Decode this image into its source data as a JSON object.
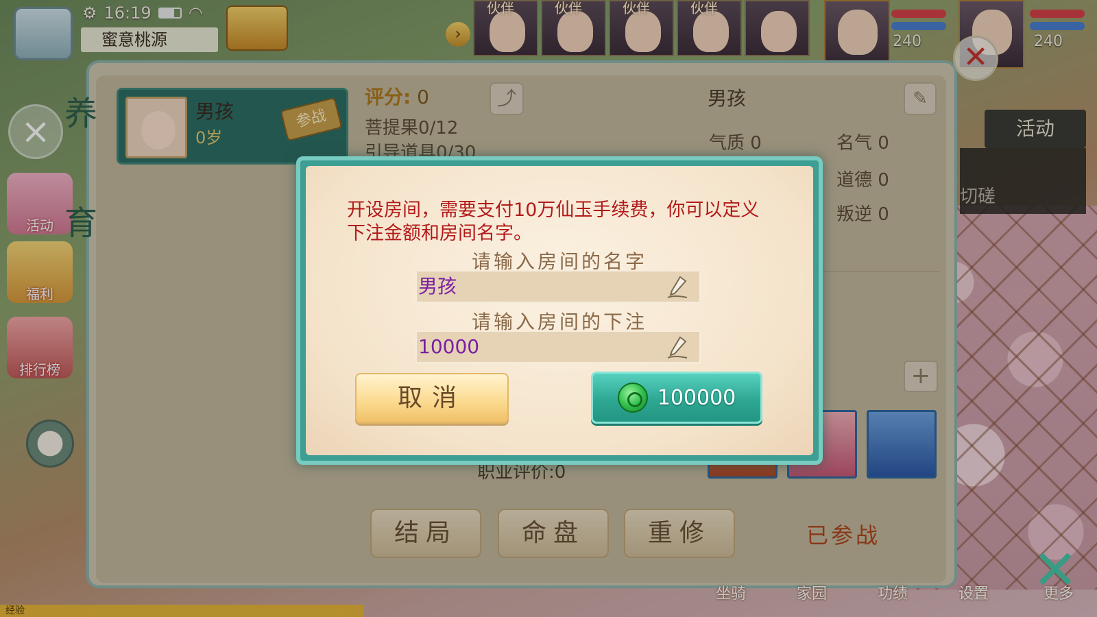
{
  "status": {
    "time": "16:19",
    "location": "蜜意桃源"
  },
  "partners": [
    {
      "label": "伙伴"
    },
    {
      "label": "伙伴"
    },
    {
      "label": "伙伴"
    },
    {
      "label": "伙伴"
    }
  ],
  "heroes": [
    {
      "level": "240"
    },
    {
      "level": "240"
    }
  ],
  "side_menu": {
    "huodong": "活动",
    "fuli": "福利",
    "paihang": "排行榜",
    "exp": "经验"
  },
  "panel": {
    "title_chars": [
      "养",
      "育"
    ],
    "child": {
      "name": "男孩",
      "age": "0岁",
      "battle_tag": "参战"
    },
    "score_label": "评分:",
    "score_value": "0",
    "fruit": "菩提果0/12",
    "guide": "引导道具0/30",
    "right_name": "男孩",
    "stats": {
      "qizhi_label": "气质",
      "qizhi_value": "0",
      "mingqi_label": "名气",
      "mingqi_value": "0",
      "daode_label": "道德",
      "daode_value": "0",
      "panni_label": "叛逆",
      "panni_value": "0"
    },
    "job_eval": "职业评价:0",
    "buttons": {
      "jieju": "结局",
      "mingpan": "命盘",
      "chongxiu": "重修"
    },
    "joined": "已参战",
    "activity_tab": "活动",
    "activity_text": "切磋"
  },
  "bottom_nav": {
    "zuoqi": "坐骑",
    "jiayuan": "家园",
    "gongji": "功绩",
    "shezhi": "设置",
    "gengduo": "更多"
  },
  "dialog": {
    "message": "开设房间，需要支付10万仙玉手续费，你可以定义下注金额和房间名字。",
    "name_label": "请输入房间的名字",
    "name_value": "男孩",
    "bet_label": "请输入房间的下注",
    "bet_value": "10000",
    "cancel_label": "取消",
    "pay_amount": "100000"
  },
  "colors": {
    "dialog_border": "#77cbc0",
    "message_red": "#b31a1a",
    "input_text": "#7a1fa2",
    "pay_button": "#2ea893"
  }
}
